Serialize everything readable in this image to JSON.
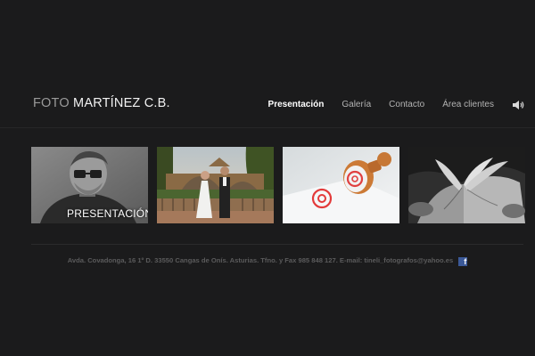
{
  "logo": {
    "part1": "FOTO",
    "part2": "MARTÍNEZ C.B."
  },
  "nav": {
    "items": [
      "Presentación",
      "Galería",
      "Contacto",
      "Área clientes"
    ],
    "active": "Presentación"
  },
  "thumbnails": [
    {
      "label": "PRESENTACIÓN"
    },
    {
      "label": ""
    },
    {
      "label": ""
    },
    {
      "label": ""
    }
  ],
  "footer": {
    "text": "Avda. Covadonga, 16 1º D. 33550 Cangas de Onís. Asturias. Tfno. y Fax 985 848 127. E-mail: tineli_fotografos@yahoo.es",
    "facebook_glyph": "f"
  },
  "colors": {
    "background": "#1b1b1c",
    "nav_active": "#ffffff",
    "nav_item": "#b3b3b3",
    "footer_text": "#5b5b5c",
    "facebook": "#3b5998"
  }
}
